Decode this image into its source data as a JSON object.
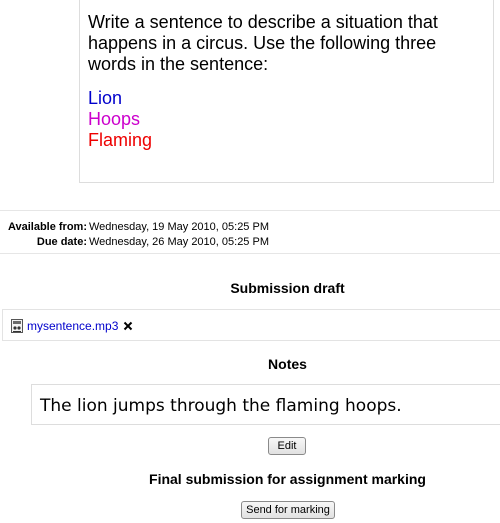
{
  "intro": {
    "text": "Write a sentence to describe a situation that happens in a circus. Use the following three words in the sentence:",
    "words": [
      {
        "text": "Lion",
        "color": "#0000cc"
      },
      {
        "text": "Hoops",
        "color": "#cc00cc"
      },
      {
        "text": "Flaming",
        "color": "#ee0000"
      }
    ]
  },
  "dates": {
    "available_label": "Available from:",
    "available_value": "Wednesday, 19 May 2010, 05:25 PM",
    "due_label": "Due date:",
    "due_value": "Wednesday, 26 May 2010, 05:25 PM"
  },
  "draft": {
    "heading": "Submission draft",
    "file_name": "mysentence.mp3",
    "file_icon": "audio-file-icon",
    "delete_icon": "delete-x-icon"
  },
  "notes": {
    "heading": "Notes",
    "text": "The lion jumps through the flaming hoops.",
    "edit_label": "Edit"
  },
  "final": {
    "heading": "Final submission for assignment marking",
    "send_label": "Send for marking"
  },
  "colors": {
    "link": "#0000cc",
    "box_border": "#dddddd"
  }
}
